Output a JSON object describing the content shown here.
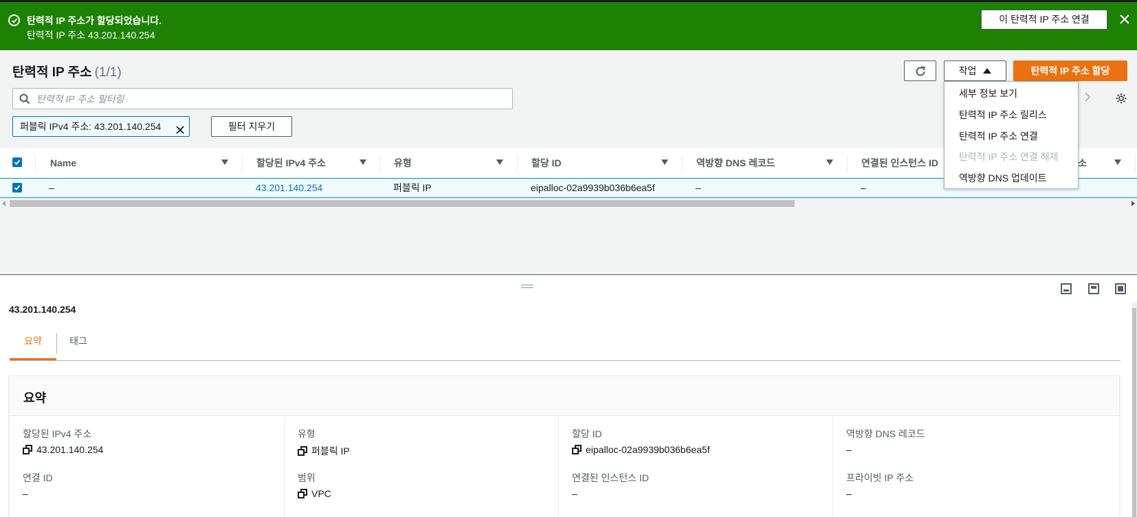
{
  "flash": {
    "title": "탄력적 IP 주소가 할당되었습니다.",
    "subtitle": "탄력적 IP 주소 43.201.140.254",
    "associate_button": "이 탄력적 IP 주소 연결",
    "bg_color": "#1d8102"
  },
  "header": {
    "title": "탄력적 IP 주소",
    "count": "(1/1)",
    "actions_button": "작업",
    "allocate_button": "탄력적 IP 주소 할당",
    "accent_color": "#ec7211"
  },
  "search": {
    "placeholder": "탄력적 IP 주소 필터링"
  },
  "filter": {
    "token": "퍼블릭 IPv4 주소: 43.201.140.254",
    "clear_button": "필터 지우기"
  },
  "table": {
    "columns": [
      "Name",
      "할당된 IPv4 주소",
      "유형",
      "할당 ID",
      "역방향 DNS 레코드",
      "연결된 인스턴스 ID",
      "프라이빗 IP 주소"
    ],
    "rows": [
      {
        "name": "–",
        "ipv4": "43.201.140.254",
        "type": "퍼블릭 IP",
        "allocation_id": "eipalloc-02a9939b036b6ea5f",
        "reverse_dns": "–",
        "instance_id": "–",
        "private_ip": "–"
      }
    ],
    "partial_header": "소"
  },
  "dropdown": {
    "items": [
      {
        "label": "세부 정보 보기",
        "disabled": false
      },
      {
        "label": "탄력적 IP 주소 릴리스",
        "disabled": false
      },
      {
        "label": "탄력적 IP 주소 연결",
        "disabled": false
      },
      {
        "label": "탄력적 IP 주소 연결 해제",
        "disabled": true
      },
      {
        "label": "역방향 DNS 업데이트",
        "disabled": false
      }
    ]
  },
  "details": {
    "title": "43.201.140.254",
    "tabs": [
      "요약",
      "태그"
    ],
    "panel_title": "요약",
    "fields": [
      {
        "label": "할당된 IPv4 주소",
        "value": "43.201.140.254",
        "copy": true
      },
      {
        "label": "유형",
        "value": "퍼블릭 IP",
        "copy": true
      },
      {
        "label": "할당 ID",
        "value": "eipalloc-02a9939b036b6ea5f",
        "copy": true
      },
      {
        "label": "역방향 DNS 레코드",
        "value": "–",
        "copy": false
      },
      {
        "label": "연결 ID",
        "value": "–",
        "copy": false
      },
      {
        "label": "범위",
        "value": "VPC",
        "copy": true
      },
      {
        "label": "연결된 인스턴스 ID",
        "value": "–",
        "copy": false
      },
      {
        "label": "프라이빗 IP 주소",
        "value": "–",
        "copy": false
      }
    ]
  }
}
